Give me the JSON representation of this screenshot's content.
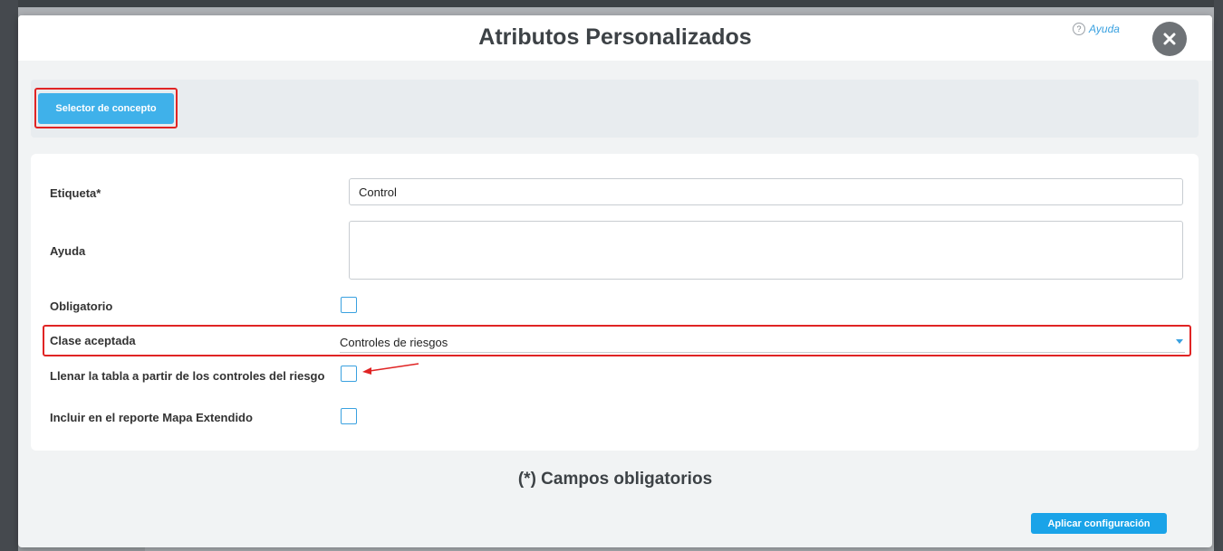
{
  "modal": {
    "title": "Atributos Personalizados",
    "help_label": "Ayuda",
    "help_symbol": "?"
  },
  "toolbar": {
    "concept_selector_label": "Selector de concepto"
  },
  "form": {
    "label_etiqueta": "Etiqueta*",
    "etiqueta_value": "Control",
    "label_ayuda": "Ayuda",
    "ayuda_value": "",
    "label_obligatorio": "Obligatorio",
    "obligatorio_checked": false,
    "label_clase": "Clase aceptada",
    "clase_value": "Controles de riesgos",
    "label_llenar": "Llenar la tabla a partir de los controles del riesgo",
    "llenar_checked": false,
    "label_incluir": "Incluir en el reporte Mapa Extendido",
    "incluir_checked": false
  },
  "footer": {
    "required_note": "(*) Campos obligatorios",
    "apply_label": "Aplicar configuración"
  },
  "colors": {
    "accent": "#3aa1e0",
    "highlight": "#e02424",
    "button": "#3fb1ea"
  }
}
